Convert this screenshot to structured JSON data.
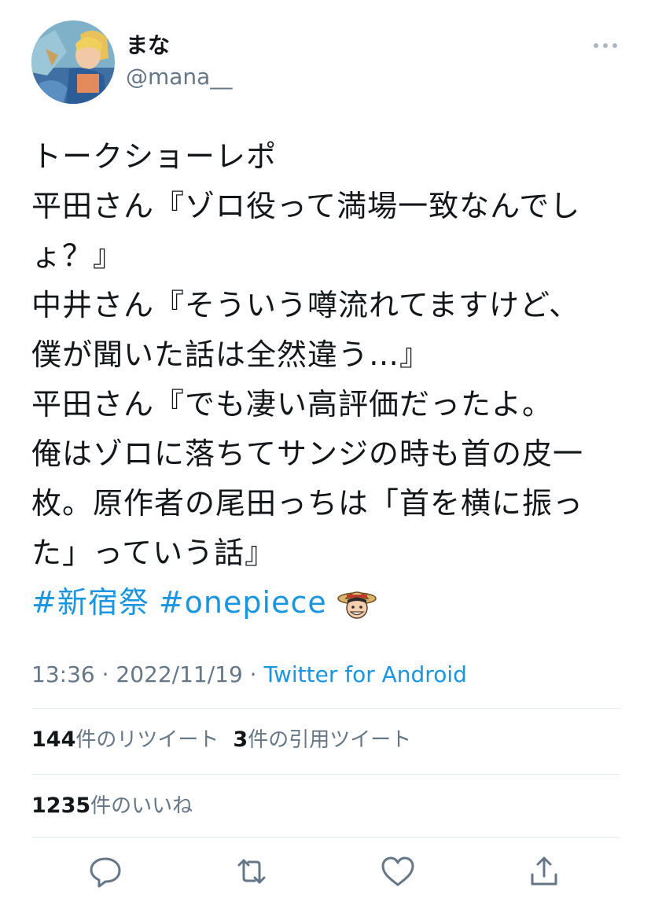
{
  "user": {
    "display_name": "まな",
    "handle": "@mana__"
  },
  "tweet": {
    "lines": [
      "トークショーレポ",
      "平田さん『ゾロ役って満場一致なんでし",
      "ょ？』",
      "中井さん『そういう噂流れてますけど、",
      "僕が聞いた話は全然違う…』",
      "平田さん『でも凄い高評価だったよ。",
      "俺はゾロに落ちてサンジの時も首の皮一",
      "枚。原作者の尾田っちは「首を横に振っ",
      "た」っていう話』"
    ],
    "hashtags": [
      "#新宿祭",
      "#onepiece"
    ],
    "emoji": "luffy-face-emoji",
    "timestamp": "13:36 · 2022/11/19 · ",
    "source": "Twitter for Android"
  },
  "stats": {
    "retweets_count": "144",
    "retweets_label": "件のリツイート",
    "quotes_count": "3",
    "quotes_label": "件の引用ツイート",
    "likes_count": "1235",
    "likes_label": "件のいいね"
  },
  "actions": {
    "icons": [
      "reply-icon",
      "retweet-icon",
      "like-icon",
      "share-icon"
    ]
  },
  "colors": {
    "accent": "#1b95e0",
    "secondary_text": "#657786",
    "primary_text": "#14171a",
    "divider": "#e1e8ed"
  }
}
